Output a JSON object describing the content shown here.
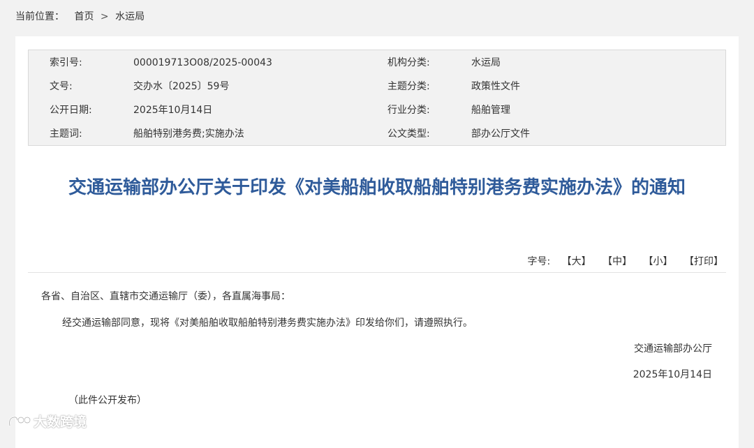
{
  "breadcrumb": {
    "label": "当前位置：",
    "home": "首页",
    "separator": ">",
    "current": "水运局"
  },
  "meta": {
    "rows": [
      {
        "label1": "索引号:",
        "value1": "000019713O08/2025-00043",
        "label2": "机构分类:",
        "value2": "水运局"
      },
      {
        "label1": "文号:",
        "value1": "交办水〔2025〕59号",
        "label2": "主题分类:",
        "value2": "政策性文件"
      },
      {
        "label1": "公开日期:",
        "value1": "2025年10月14日",
        "label2": "行业分类:",
        "value2": "船舶管理"
      },
      {
        "label1": "主题词:",
        "value1": "船舶特别港务费;实施办法",
        "label2": "公文类型:",
        "value2": "部办公厅文件"
      }
    ]
  },
  "document": {
    "title": "交通运输部办公厅关于印发《对美船舶收取船舶特别港务费实施办法》的通知",
    "salutation": "各省、自治区、直辖市交通运输厅（委），各直属海事局：",
    "paragraph": "经交通运输部同意，现将《对美船舶收取船舶特别港务费实施办法》印发给你们，请遵照执行。",
    "signature_org": "交通运输部办公厅",
    "signature_date": "2025年10月14日",
    "note": "（此件公开发布）"
  },
  "tools": {
    "font_size_label": "字号:",
    "large": "【大】",
    "medium": "【中】",
    "small": "【小】",
    "print": "【打印】"
  },
  "watermark": {
    "text": "大数跨境"
  },
  "colors": {
    "title": "#2f5b9a",
    "meta_background": "#f2f2f2",
    "page_background": "#f2f2f2"
  }
}
